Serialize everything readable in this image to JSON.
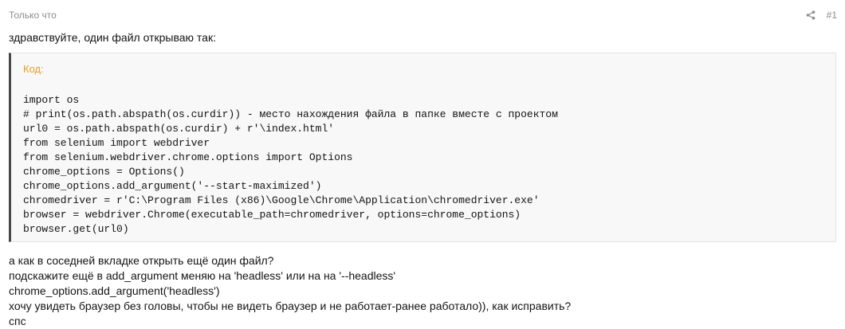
{
  "post": {
    "timestamp": "Только что",
    "number": "#1",
    "icons": {
      "share": "share-icon"
    },
    "intro": "здравствуйте, один файл открываю так:",
    "code": {
      "title": "Код:",
      "lines": [
        "import os",
        "# print(os.path.abspath(os.curdir)) - место нахождения файла в папке вместе с проектом",
        "url0 = os.path.abspath(os.curdir) + r'\\index.html'",
        "from selenium import webdriver",
        "from selenium.webdriver.chrome.options import Options",
        "chrome_options = Options()",
        "chrome_options.add_argument('--start-maximized')",
        "chromedriver = r'C:\\Program Files (x86)\\Google\\Chrome\\Application\\chromedriver.exe'",
        "browser = webdriver.Chrome(executable_path=chromedriver, options=chrome_options)",
        "browser.get(url0)"
      ]
    },
    "message_lines": [
      "а как в соседней вкладке открыть ещё один файл?",
      "подскажите ещё в add_argument меняю на 'headless' или на на '--headless'",
      "chrome_options.add_argument('headless')",
      "хочу увидеть браузер без головы, чтобы не видеть браузер и не работает-ранее работало)), как исправить?",
      "спс"
    ]
  },
  "colors": {
    "background": "#ffffff",
    "muted_text": "#8c8c8c",
    "code_title": "#e8a21a",
    "code_background": "#f8f8f8",
    "code_border_left": "#474747"
  }
}
